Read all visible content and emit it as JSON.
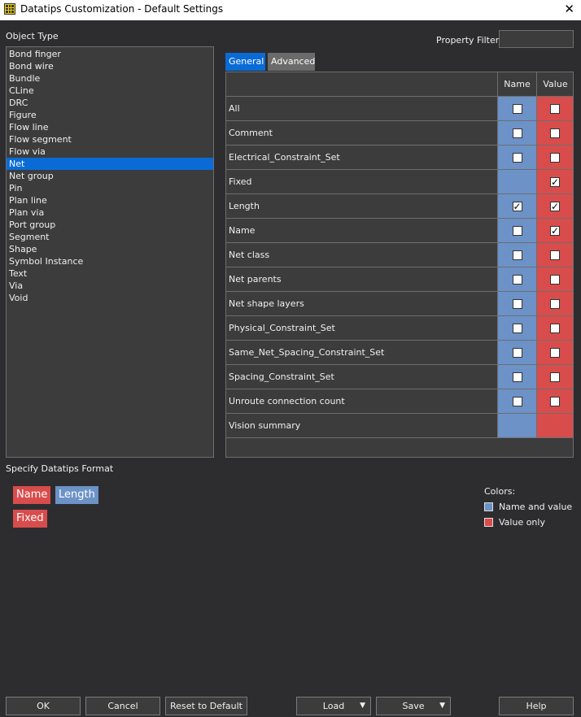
{
  "window": {
    "title": "Datatips Customization - Default Settings"
  },
  "object_type": {
    "label": "Object Type",
    "items": [
      "Bond finger",
      "Bond wire",
      "Bundle",
      "CLine",
      "DRC",
      "Figure",
      "Flow line",
      "Flow segment",
      "Flow via",
      "Net",
      "Net group",
      "Pin",
      "Plan line",
      "Plan via",
      "Port group",
      "Segment",
      "Shape",
      "Symbol Instance",
      "Text",
      "Via",
      "Void"
    ],
    "selected": "Net"
  },
  "property_filter": {
    "label": "Property Filter",
    "value": ""
  },
  "tabs": {
    "general": "General",
    "advanced": "Advanced"
  },
  "grid": {
    "headers": {
      "name": "Name",
      "value": "Value"
    },
    "rows": [
      {
        "label": "All",
        "name": "unchecked",
        "value": "unchecked"
      },
      {
        "label": "Comment",
        "name": "unchecked",
        "value": "unchecked"
      },
      {
        "label": "Electrical_Constraint_Set",
        "name": "unchecked",
        "value": "unchecked"
      },
      {
        "label": "Fixed",
        "name": "none",
        "value": "checked"
      },
      {
        "label": "Length",
        "name": "checked",
        "value": "checked"
      },
      {
        "label": "Name",
        "name": "unchecked",
        "value": "checked"
      },
      {
        "label": "Net class",
        "name": "unchecked",
        "value": "unchecked"
      },
      {
        "label": "Net parents",
        "name": "unchecked",
        "value": "unchecked"
      },
      {
        "label": "Net shape layers",
        "name": "unchecked",
        "value": "unchecked"
      },
      {
        "label": "Physical_Constraint_Set",
        "name": "unchecked",
        "value": "unchecked"
      },
      {
        "label": "Same_Net_Spacing_Constraint_Set",
        "name": "unchecked",
        "value": "unchecked"
      },
      {
        "label": "Spacing_Constraint_Set",
        "name": "unchecked",
        "value": "unchecked"
      },
      {
        "label": "Unroute connection count",
        "name": "unchecked",
        "value": "unchecked"
      },
      {
        "label": "Vision summary",
        "name": "none",
        "value": "none"
      }
    ]
  },
  "format": {
    "label": "Specify Datatips Format",
    "chips": [
      {
        "text": "Name",
        "kind": "value-only"
      },
      {
        "text": "Length",
        "kind": "name-and-value"
      },
      {
        "text": "Fixed",
        "kind": "value-only"
      }
    ]
  },
  "legend": {
    "title": "Colors:",
    "name_and_value": "Name and value",
    "value_only": "Value only",
    "name_and_value_color": "#6c92c7",
    "value_only_color": "#d94c4c"
  },
  "buttons": {
    "ok": "OK",
    "cancel": "Cancel",
    "reset": "Reset to Default",
    "load": "Load",
    "save": "Save",
    "help": "Help"
  },
  "icons": {
    "close": "close-icon",
    "app": "app-grid-icon",
    "dropdown": "caret-down-icon",
    "check": "check-icon"
  }
}
